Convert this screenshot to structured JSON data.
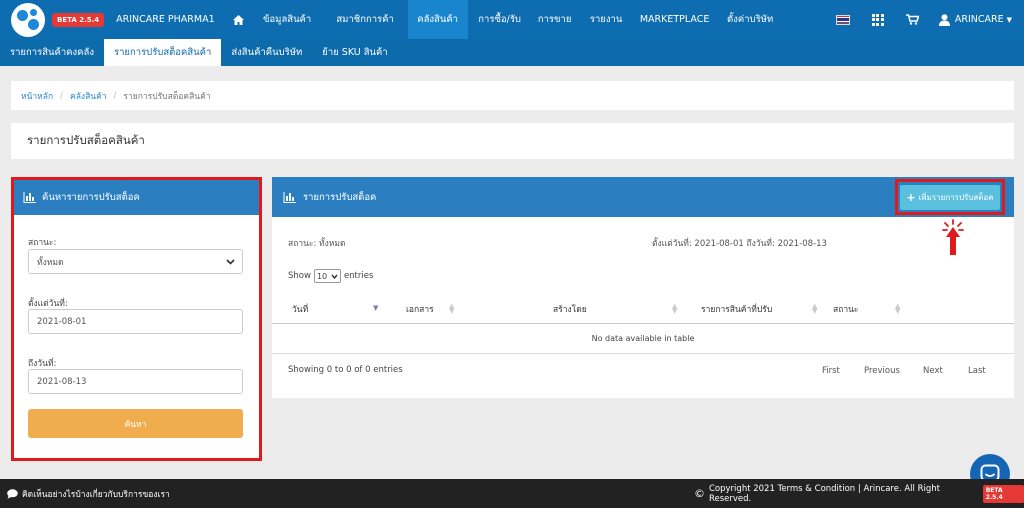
{
  "nav": {
    "beta": "BETA 2.5.4",
    "brand": "ARINCARE PHARMA1",
    "menu": [
      "ข้อมูลสินค้า",
      "สมาชิกการค้า",
      "คลังสินค้า",
      "การซื้อ/รับ",
      "การขาย",
      "รายงาน",
      "MARKETPLACE",
      "ตั้งค่าบริษัท"
    ],
    "active_menu": "คลังสินค้า",
    "user": "ARINCARE"
  },
  "subnav": {
    "items": [
      "รายการสินค้าคงคลัง",
      "รายการปรับสต็อคสินค้า",
      "ส่งสินค้าคืนบริษัท",
      "ย้าย SKU สินค้า"
    ],
    "active": "รายการปรับสต็อคสินค้า"
  },
  "breadcrumb": {
    "home": "หน้าหลัก",
    "inventory": "คลังสินค้า",
    "current": "รายการปรับสต็อคสินค้า",
    "separator": "/"
  },
  "page": {
    "title": "รายการปรับสต็อคสินค้า"
  },
  "search": {
    "title": "ค้นหารายการปรับสต็อค",
    "status_label": "สถานะ:",
    "status_value": "ทั้งหมด",
    "from_label": "ตั้งแต่วันที่:",
    "from_value": "2021-08-01",
    "to_label": "ถึงวันที่:",
    "to_value": "2021-08-13",
    "button": "ค้นหา"
  },
  "list": {
    "title": "รายการปรับสต็อค",
    "add_button": "เพิ่มรายการปรับสต็อค",
    "status_text": "สถานะ: ทั้งหมด",
    "date_text": "ตั้งแต่วันที่: 2021-08-01  ถึงวันที่: 2021-08-13",
    "show_prefix": "Show",
    "show_value": "10",
    "show_suffix": "entries",
    "columns": [
      "วันที่",
      "เอกสาร",
      "สร้างโดย",
      "รายการสินค้าที่ปรับ",
      "สถานะ"
    ],
    "empty": "No data available in table",
    "showing": "Showing 0 to 0 of 0 entries",
    "pager": [
      "First",
      "Previous",
      "Next",
      "Last"
    ]
  },
  "footer": {
    "feedback": "คิดเห็นอย่างไรบ้างเกี่ยวกับบริการของเรา",
    "copyright": "Copyright  2021   Terms & Condition |   Arincare. All Right Reserved.",
    "beta": "BETA 2.5.4"
  },
  "colors": {
    "nav": "#0e6db0",
    "panel_header": "#2b7fc1",
    "highlight": "#e01a1a",
    "search_button": "#f0ad4e",
    "add_button": "#5bc0de"
  }
}
